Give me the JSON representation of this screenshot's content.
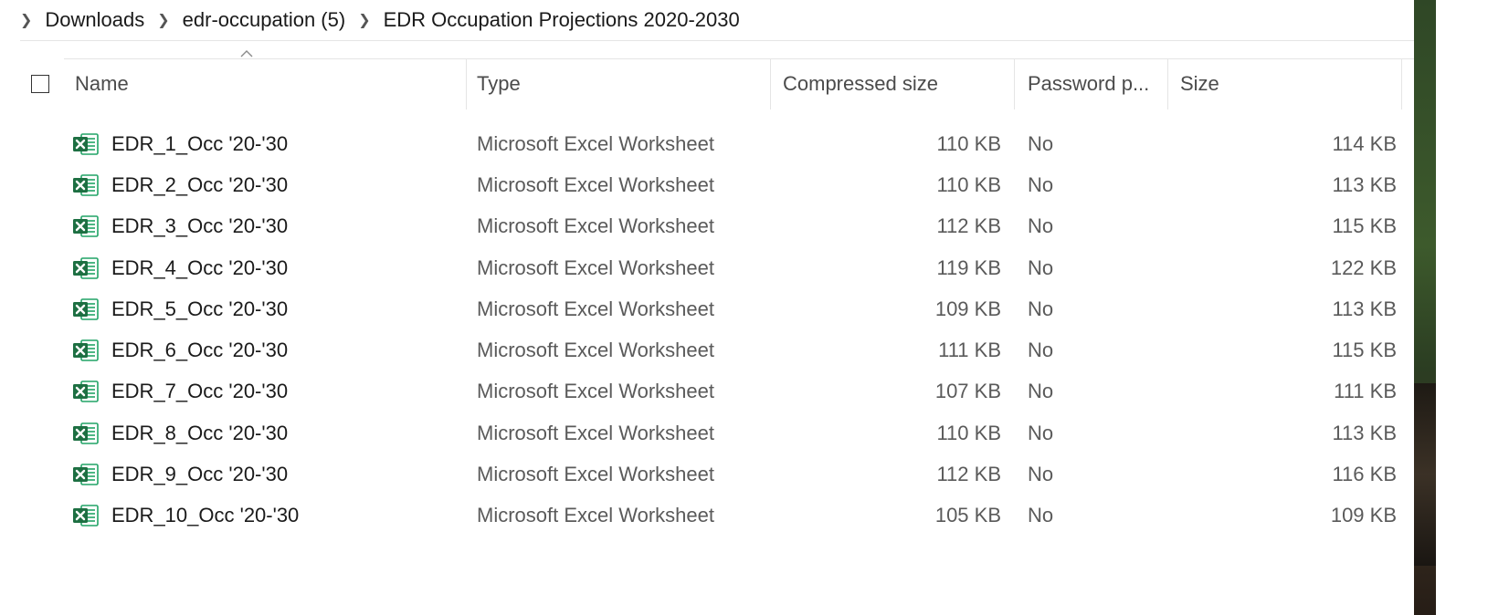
{
  "breadcrumb": {
    "items": [
      "Downloads",
      "edr-occupation (5)",
      "EDR Occupation Projections 2020-2030"
    ]
  },
  "columns": {
    "name": "Name",
    "type": "Type",
    "compressed_size": "Compressed size",
    "password": "Password p...",
    "size": "Size"
  },
  "colors": {
    "excel_green": "#1d6f42",
    "excel_light": "#21a366",
    "text_primary": "#1a1a1a",
    "text_secondary": "#5a5a5a",
    "separator": "#e5e5e5"
  },
  "icons": {
    "breadcrumb_chevron": "chevron-right-icon",
    "file_icon": "excel-file-icon",
    "sort": "sort-ascending-icon"
  },
  "files": [
    {
      "name": "EDR_1_Occ '20-'30",
      "type": "Microsoft Excel Worksheet",
      "compressed_size": "110 KB",
      "password": "No",
      "size": "114 KB"
    },
    {
      "name": "EDR_2_Occ '20-'30",
      "type": "Microsoft Excel Worksheet",
      "compressed_size": "110 KB",
      "password": "No",
      "size": "113 KB"
    },
    {
      "name": "EDR_3_Occ '20-'30",
      "type": "Microsoft Excel Worksheet",
      "compressed_size": "112 KB",
      "password": "No",
      "size": "115 KB"
    },
    {
      "name": "EDR_4_Occ '20-'30",
      "type": "Microsoft Excel Worksheet",
      "compressed_size": "119 KB",
      "password": "No",
      "size": "122 KB"
    },
    {
      "name": "EDR_5_Occ '20-'30",
      "type": "Microsoft Excel Worksheet",
      "compressed_size": "109 KB",
      "password": "No",
      "size": "113 KB"
    },
    {
      "name": "EDR_6_Occ '20-'30",
      "type": "Microsoft Excel Worksheet",
      "compressed_size": "111 KB",
      "password": "No",
      "size": "115 KB"
    },
    {
      "name": "EDR_7_Occ '20-'30",
      "type": "Microsoft Excel Worksheet",
      "compressed_size": "107 KB",
      "password": "No",
      "size": "111 KB"
    },
    {
      "name": "EDR_8_Occ '20-'30",
      "type": "Microsoft Excel Worksheet",
      "compressed_size": "110 KB",
      "password": "No",
      "size": "113 KB"
    },
    {
      "name": "EDR_9_Occ '20-'30",
      "type": "Microsoft Excel Worksheet",
      "compressed_size": "112 KB",
      "password": "No",
      "size": "116 KB"
    },
    {
      "name": "EDR_10_Occ '20-'30",
      "type": "Microsoft Excel Worksheet",
      "compressed_size": "105 KB",
      "password": "No",
      "size": "109 KB"
    }
  ]
}
